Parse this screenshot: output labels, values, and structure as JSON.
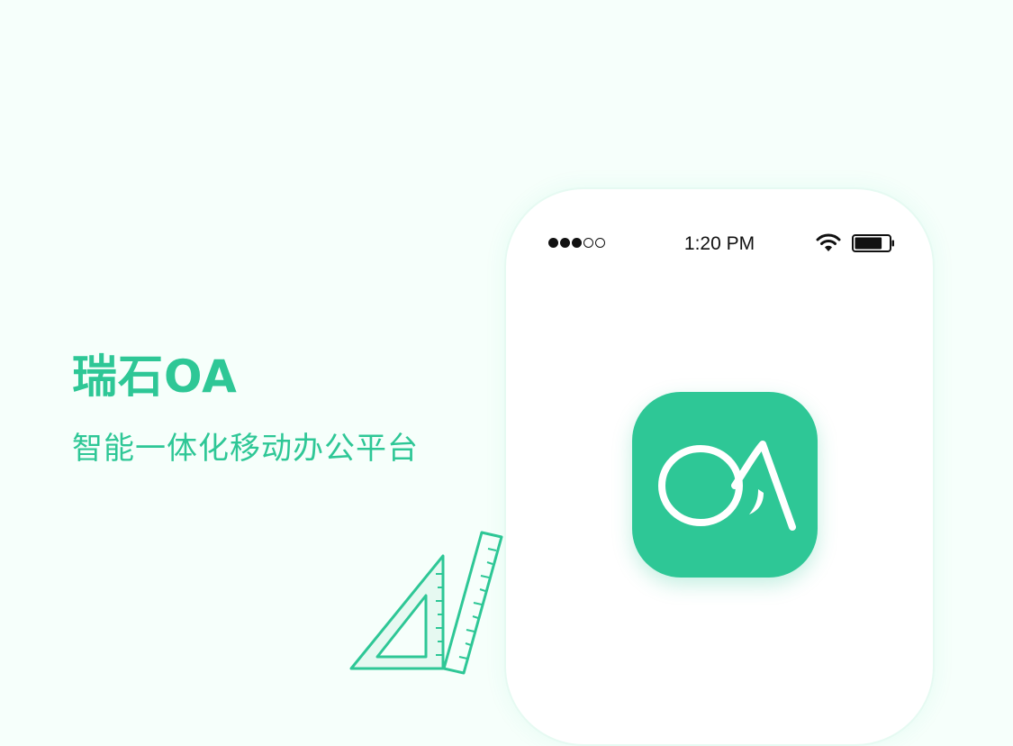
{
  "hero": {
    "title": "瑞石OA",
    "subtitle": "智能一体化移动办公平台"
  },
  "phone": {
    "status_bar": {
      "time": "1:20 PM",
      "signal_bars_filled": 3,
      "signal_bars_total": 5,
      "wifi_icon": "wifi-icon",
      "battery_icon": "battery-icon",
      "battery_level": 0.8
    },
    "app_icon": {
      "name": "oa-logo-icon",
      "logo_text": "OA"
    }
  },
  "decoration": {
    "icon": "ruler-triangle-icon"
  },
  "colors": {
    "accent": "#2ec796",
    "background": "#f6fffb",
    "text_dark": "#111111"
  }
}
